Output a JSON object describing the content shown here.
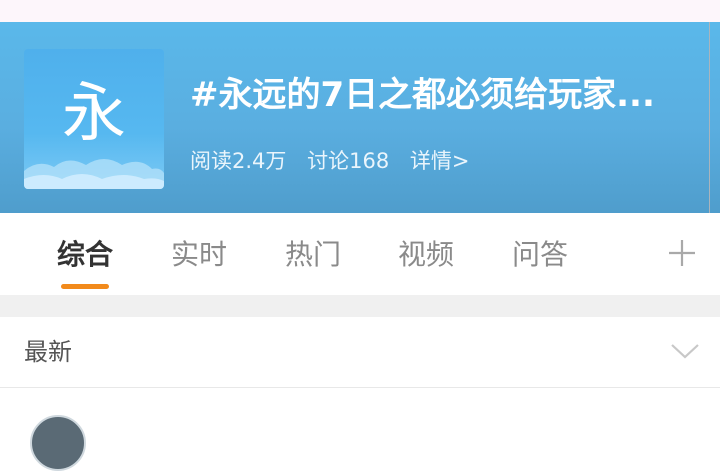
{
  "topic": {
    "avatar_char": "永",
    "title": "#永远的7日之都必须给玩家...",
    "reads": "阅读2.4万",
    "discussions": "讨论168",
    "details": "详情>"
  },
  "tabs": [
    {
      "label": "综合",
      "active": true
    },
    {
      "label": "实时",
      "active": false
    },
    {
      "label": "热门",
      "active": false
    },
    {
      "label": "视频",
      "active": false
    },
    {
      "label": "问答",
      "active": false
    }
  ],
  "section": {
    "title": "最新"
  },
  "colors": {
    "hero": "#5ab8ea",
    "accent": "#f28a1b"
  },
  "icons": {
    "add_tab": "plus-icon",
    "expand": "chevron-down-icon"
  }
}
